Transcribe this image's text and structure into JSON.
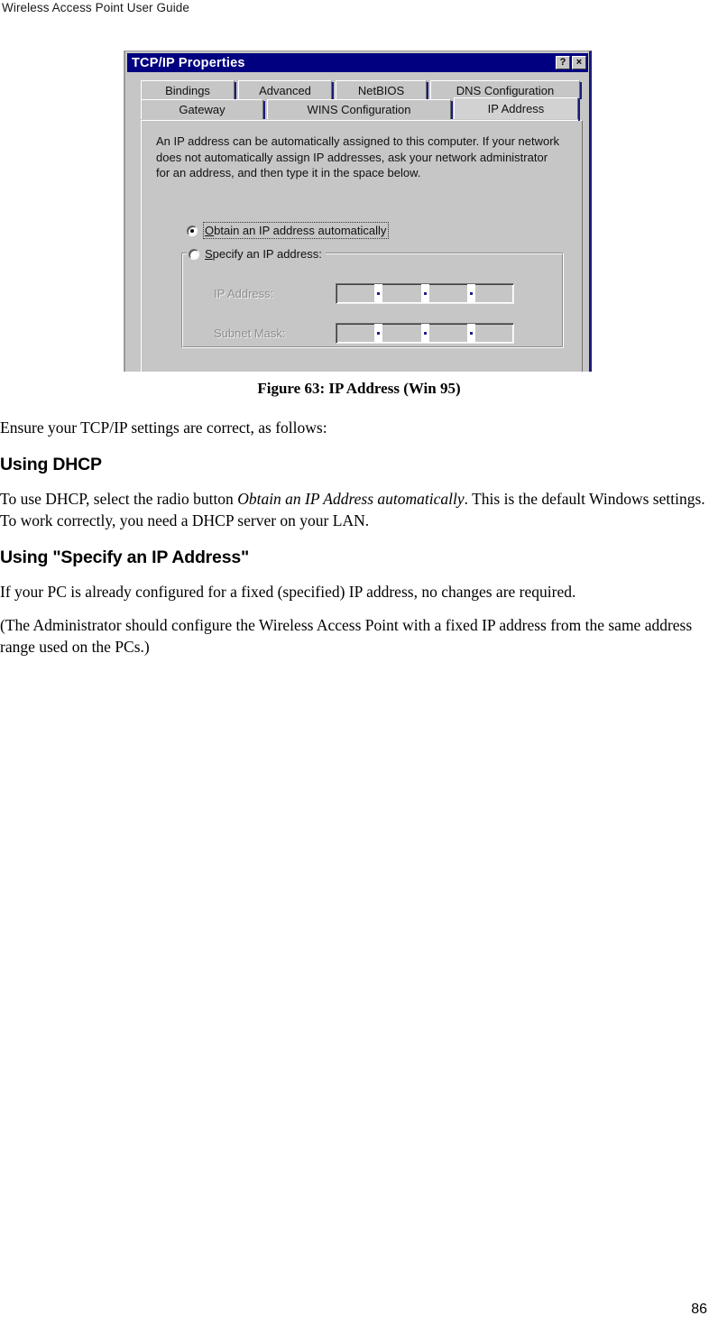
{
  "header": {
    "running_title": "Wireless Access Point User Guide"
  },
  "figure": {
    "caption": "Figure 63:  IP Address (Win 95)",
    "dialog": {
      "title": "TCP/IP Properties",
      "help_button": "?",
      "close_button": "×",
      "tabs_row1": [
        {
          "label": "Bindings",
          "active": false
        },
        {
          "label": "Advanced",
          "active": false
        },
        {
          "label": "NetBIOS",
          "active": false
        },
        {
          "label": "DNS Configuration",
          "active": false
        }
      ],
      "tabs_row2": [
        {
          "label": "Gateway",
          "active": false
        },
        {
          "label": "WINS Configuration",
          "active": false
        },
        {
          "label": "IP Address",
          "active": true
        }
      ],
      "description": "An IP address can be automatically assigned to this computer.  If your network does not automatically assign IP addresses, ask your network administrator for an address, and then type it in the space below.",
      "radio_auto_label": "Obtain an IP address automatically",
      "radio_auto_selected": true,
      "radio_specify_label": "Specify an IP address:",
      "radio_specify_selected": false,
      "ip_address_label": "IP Address:",
      "ip_address_value": "",
      "subnet_mask_label": "Subnet Mask:",
      "subnet_mask_value": "",
      "colors": {
        "titlebar": "#000080",
        "face": "#c6c6c6",
        "disabled_text": "#8e8e8e",
        "frame_accent": "#1b1b7a"
      }
    }
  },
  "body": {
    "intro": "Ensure your TCP/IP settings are correct, as follows:",
    "section_dhcp": {
      "heading": "Using DHCP",
      "paragraph_pre_italic": "To use DHCP, select the radio button ",
      "paragraph_italic": "Obtain an IP Address automatically",
      "paragraph_post_italic": ". This is the default Windows settings. To work correctly, you need a DHCP server on your LAN."
    },
    "section_specify": {
      "heading": "Using \"Specify an IP Address\"",
      "paragraph_1": "If your PC is already configured for a fixed (specified) IP address, no changes are required.",
      "paragraph_2": "(The Administrator should configure the Wireless Access Point with a fixed IP address from the same address range used on the PCs.)"
    }
  },
  "footer": {
    "page_number": "86"
  }
}
